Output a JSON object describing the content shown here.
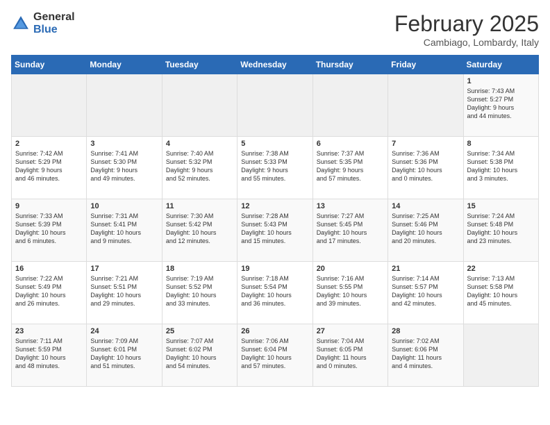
{
  "header": {
    "logo_general": "General",
    "logo_blue": "Blue",
    "month_year": "February 2025",
    "location": "Cambiago, Lombardy, Italy"
  },
  "days_of_week": [
    "Sunday",
    "Monday",
    "Tuesday",
    "Wednesday",
    "Thursday",
    "Friday",
    "Saturday"
  ],
  "weeks": [
    [
      {
        "num": "",
        "info": ""
      },
      {
        "num": "",
        "info": ""
      },
      {
        "num": "",
        "info": ""
      },
      {
        "num": "",
        "info": ""
      },
      {
        "num": "",
        "info": ""
      },
      {
        "num": "",
        "info": ""
      },
      {
        "num": "1",
        "info": "Sunrise: 7:43 AM\nSunset: 5:27 PM\nDaylight: 9 hours\nand 44 minutes."
      }
    ],
    [
      {
        "num": "2",
        "info": "Sunrise: 7:42 AM\nSunset: 5:29 PM\nDaylight: 9 hours\nand 46 minutes."
      },
      {
        "num": "3",
        "info": "Sunrise: 7:41 AM\nSunset: 5:30 PM\nDaylight: 9 hours\nand 49 minutes."
      },
      {
        "num": "4",
        "info": "Sunrise: 7:40 AM\nSunset: 5:32 PM\nDaylight: 9 hours\nand 52 minutes."
      },
      {
        "num": "5",
        "info": "Sunrise: 7:38 AM\nSunset: 5:33 PM\nDaylight: 9 hours\nand 55 minutes."
      },
      {
        "num": "6",
        "info": "Sunrise: 7:37 AM\nSunset: 5:35 PM\nDaylight: 9 hours\nand 57 minutes."
      },
      {
        "num": "7",
        "info": "Sunrise: 7:36 AM\nSunset: 5:36 PM\nDaylight: 10 hours\nand 0 minutes."
      },
      {
        "num": "8",
        "info": "Sunrise: 7:34 AM\nSunset: 5:38 PM\nDaylight: 10 hours\nand 3 minutes."
      }
    ],
    [
      {
        "num": "9",
        "info": "Sunrise: 7:33 AM\nSunset: 5:39 PM\nDaylight: 10 hours\nand 6 minutes."
      },
      {
        "num": "10",
        "info": "Sunrise: 7:31 AM\nSunset: 5:41 PM\nDaylight: 10 hours\nand 9 minutes."
      },
      {
        "num": "11",
        "info": "Sunrise: 7:30 AM\nSunset: 5:42 PM\nDaylight: 10 hours\nand 12 minutes."
      },
      {
        "num": "12",
        "info": "Sunrise: 7:28 AM\nSunset: 5:43 PM\nDaylight: 10 hours\nand 15 minutes."
      },
      {
        "num": "13",
        "info": "Sunrise: 7:27 AM\nSunset: 5:45 PM\nDaylight: 10 hours\nand 17 minutes."
      },
      {
        "num": "14",
        "info": "Sunrise: 7:25 AM\nSunset: 5:46 PM\nDaylight: 10 hours\nand 20 minutes."
      },
      {
        "num": "15",
        "info": "Sunrise: 7:24 AM\nSunset: 5:48 PM\nDaylight: 10 hours\nand 23 minutes."
      }
    ],
    [
      {
        "num": "16",
        "info": "Sunrise: 7:22 AM\nSunset: 5:49 PM\nDaylight: 10 hours\nand 26 minutes."
      },
      {
        "num": "17",
        "info": "Sunrise: 7:21 AM\nSunset: 5:51 PM\nDaylight: 10 hours\nand 29 minutes."
      },
      {
        "num": "18",
        "info": "Sunrise: 7:19 AM\nSunset: 5:52 PM\nDaylight: 10 hours\nand 33 minutes."
      },
      {
        "num": "19",
        "info": "Sunrise: 7:18 AM\nSunset: 5:54 PM\nDaylight: 10 hours\nand 36 minutes."
      },
      {
        "num": "20",
        "info": "Sunrise: 7:16 AM\nSunset: 5:55 PM\nDaylight: 10 hours\nand 39 minutes."
      },
      {
        "num": "21",
        "info": "Sunrise: 7:14 AM\nSunset: 5:57 PM\nDaylight: 10 hours\nand 42 minutes."
      },
      {
        "num": "22",
        "info": "Sunrise: 7:13 AM\nSunset: 5:58 PM\nDaylight: 10 hours\nand 45 minutes."
      }
    ],
    [
      {
        "num": "23",
        "info": "Sunrise: 7:11 AM\nSunset: 5:59 PM\nDaylight: 10 hours\nand 48 minutes."
      },
      {
        "num": "24",
        "info": "Sunrise: 7:09 AM\nSunset: 6:01 PM\nDaylight: 10 hours\nand 51 minutes."
      },
      {
        "num": "25",
        "info": "Sunrise: 7:07 AM\nSunset: 6:02 PM\nDaylight: 10 hours\nand 54 minutes."
      },
      {
        "num": "26",
        "info": "Sunrise: 7:06 AM\nSunset: 6:04 PM\nDaylight: 10 hours\nand 57 minutes."
      },
      {
        "num": "27",
        "info": "Sunrise: 7:04 AM\nSunset: 6:05 PM\nDaylight: 11 hours\nand 0 minutes."
      },
      {
        "num": "28",
        "info": "Sunrise: 7:02 AM\nSunset: 6:06 PM\nDaylight: 11 hours\nand 4 minutes."
      },
      {
        "num": "",
        "info": ""
      }
    ]
  ]
}
